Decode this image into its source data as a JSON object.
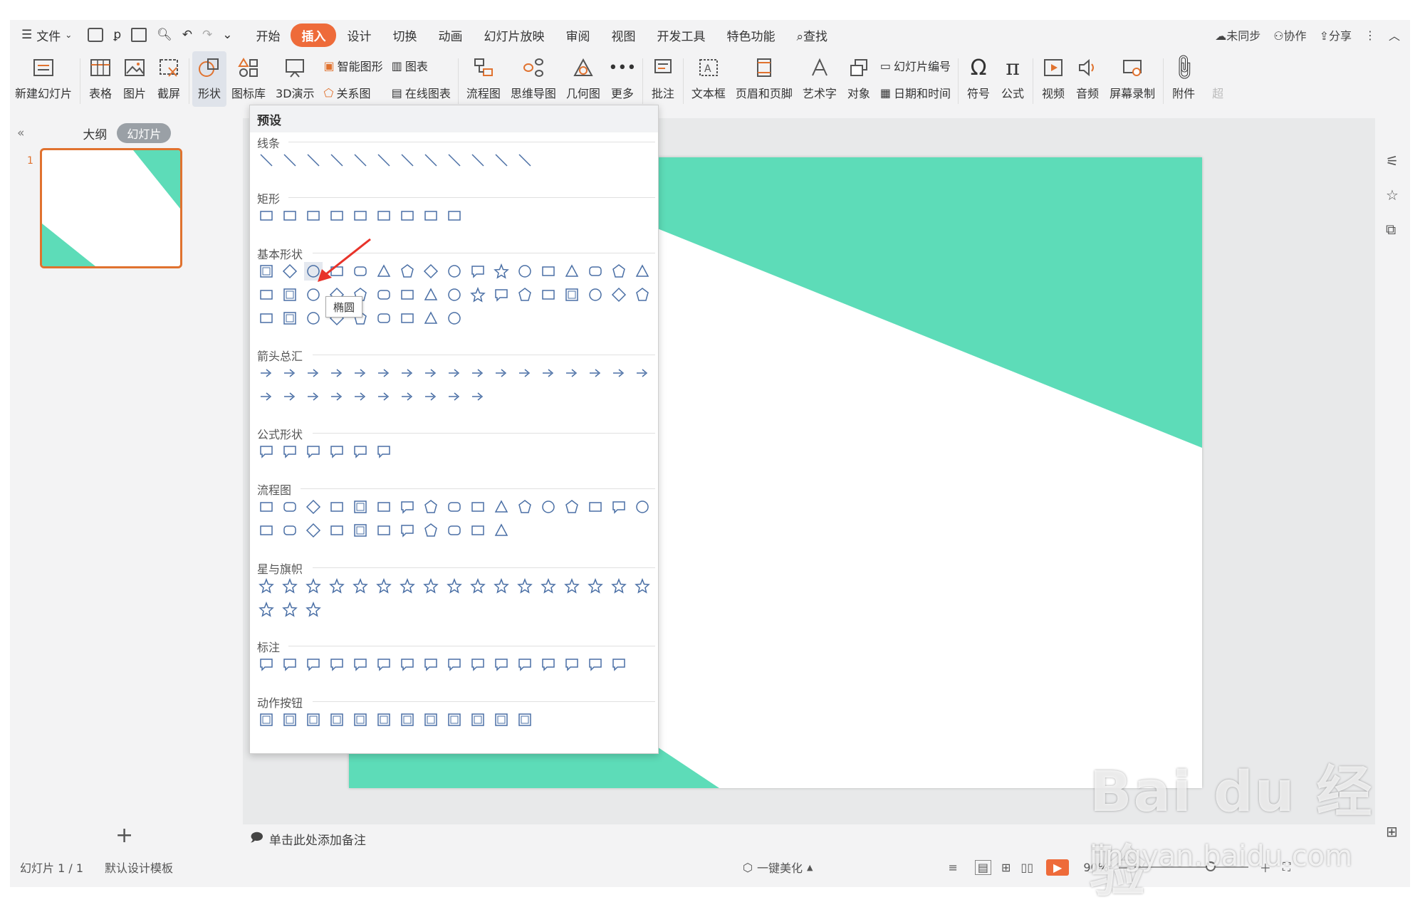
{
  "menu": {
    "file_label": "文件"
  },
  "tabs": [
    "开始",
    "插入",
    "设计",
    "切换",
    "动画",
    "幻灯片放映",
    "审阅",
    "视图",
    "开发工具",
    "特色功能"
  ],
  "active_tab": "插入",
  "search_label": "查找",
  "top_right": {
    "sync": "未同步",
    "collab": "协作",
    "share": "分享"
  },
  "ribbon": {
    "new_slide": "新建幻灯片",
    "table": "表格",
    "picture": "图片",
    "screenshot": "截屏",
    "shape": "形状",
    "icon_lib": "图标库",
    "demo3d": "3D演示",
    "smart_shape": "智能图形",
    "chart": "图表",
    "relation": "关系图",
    "online_chart": "在线图表",
    "flowchart": "流程图",
    "mindmap": "思维导图",
    "geometry": "几何图",
    "more": "更多",
    "comment": "批注",
    "textbox": "文本框",
    "header_footer": "页眉和页脚",
    "wordart": "艺术字",
    "object": "对象",
    "slide_number": "幻灯片编号",
    "datetime": "日期和时间",
    "symbol": "符号",
    "formula": "公式",
    "video": "视频",
    "audio": "音频",
    "screen_record": "屏幕录制",
    "attachment": "附件",
    "overflow": "超"
  },
  "left_panel": {
    "outline_tab": "大纲",
    "slides_tab": "幻灯片",
    "slide_index": "1"
  },
  "shapes_menu": {
    "header": "预设",
    "sections": [
      "线条",
      "矩形",
      "基本形状",
      "箭头总汇",
      "公式形状",
      "流程图",
      "星与旗帜",
      "标注",
      "动作按钮"
    ],
    "tooltip": "椭圆"
  },
  "notes_placeholder": "单击此处添加备注",
  "status": {
    "slide_count": "幻灯片 1 / 1",
    "template": "默认设计模板",
    "beautify": "一键美化",
    "zoom": "90%"
  },
  "watermark": {
    "line1": "Bai du 经验",
    "line2": "jingyan.baidu.com"
  },
  "colors": {
    "accent": "#ee6b3a",
    "slide_green": "#5ddcb8",
    "thumb_border": "#e0722f",
    "shape_stroke": "#4a6fa5"
  }
}
